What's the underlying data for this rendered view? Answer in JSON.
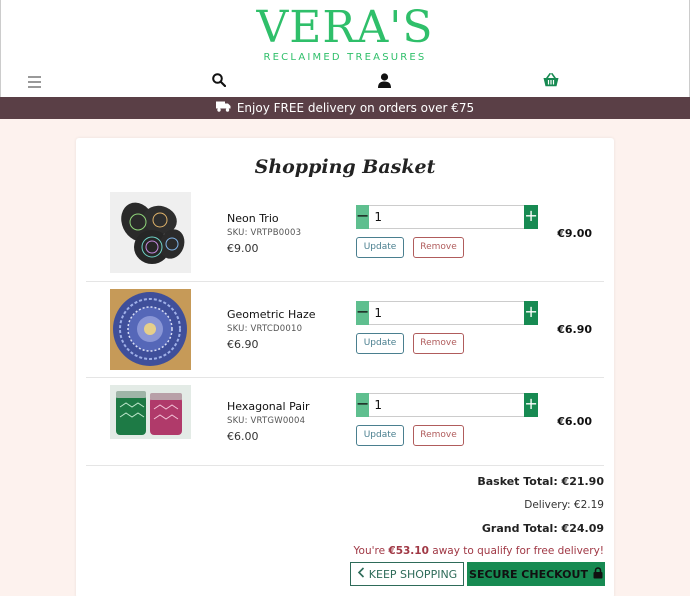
{
  "logo": {
    "main": "VERA'S",
    "sub": "RECLAIMED TREASURES"
  },
  "banner": {
    "text": "Enjoy FREE delivery on orders over €75"
  },
  "basket": {
    "title": "Shopping Basket",
    "items": [
      {
        "name": "Neon Trio",
        "sku": "SKU: VRTPB0003",
        "price": "€9.00",
        "qty": "1",
        "subtotal": "€9.00"
      },
      {
        "name": "Geometric Haze",
        "sku": "SKU: VRTCD0010",
        "price": "€6.90",
        "qty": "1",
        "subtotal": "€6.90"
      },
      {
        "name": "Hexagonal Pair",
        "sku": "SKU: VRTGW0004",
        "price": "€6.00",
        "qty": "1",
        "subtotal": "€6.00"
      }
    ],
    "update_label": "Update",
    "remove_label": "Remove",
    "minus_label": "−",
    "plus_label": "+"
  },
  "totals": {
    "basket_total": "Basket Total: €21.90",
    "delivery": "Delivery: €2.19",
    "grand_total": "Grand Total: €24.09",
    "promo_pre": "You're ",
    "promo_amount": "€53.10",
    "promo_post": " away to qualify for free delivery!"
  },
  "actions": {
    "keep_shopping": "KEEP SHOPPING",
    "secure_checkout": "SECURE CHECKOUT"
  },
  "colors": {
    "brand": "#2fbf6a",
    "banner": "#5a3f46",
    "checkout": "#178a52",
    "page_bg": "#fdf2ee"
  },
  "icons": [
    "hamburger-icon",
    "search-icon",
    "user-icon",
    "basket-icon",
    "truck-icon",
    "chevron-left-icon",
    "lock-icon"
  ]
}
